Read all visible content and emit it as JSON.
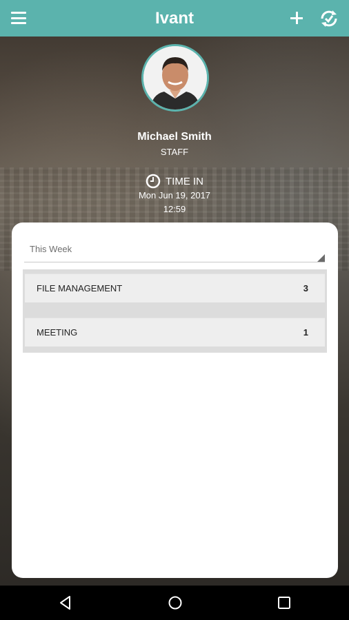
{
  "app": {
    "title": "Ivant",
    "accent_color": "#5bb3ad"
  },
  "toolbar": {
    "menu_icon": "hamburger-menu-icon",
    "add_icon": "plus-icon",
    "sync_icon": "sync-check-icon"
  },
  "profile": {
    "name": "Michael Smith",
    "role": "STAFF",
    "status_icon": "clock-icon",
    "status_label": "TIME IN",
    "date": "Mon Jun 19, 2017",
    "time": "12:59"
  },
  "summary": {
    "period_selected": "This Week",
    "items": [
      {
        "label": "FILE MANAGEMENT",
        "count": "3"
      },
      {
        "label": "MEETING",
        "count": "1"
      }
    ]
  },
  "system_nav": {
    "back_icon": "back-triangle-icon",
    "home_icon": "home-circle-icon",
    "recents_icon": "recents-square-icon"
  }
}
